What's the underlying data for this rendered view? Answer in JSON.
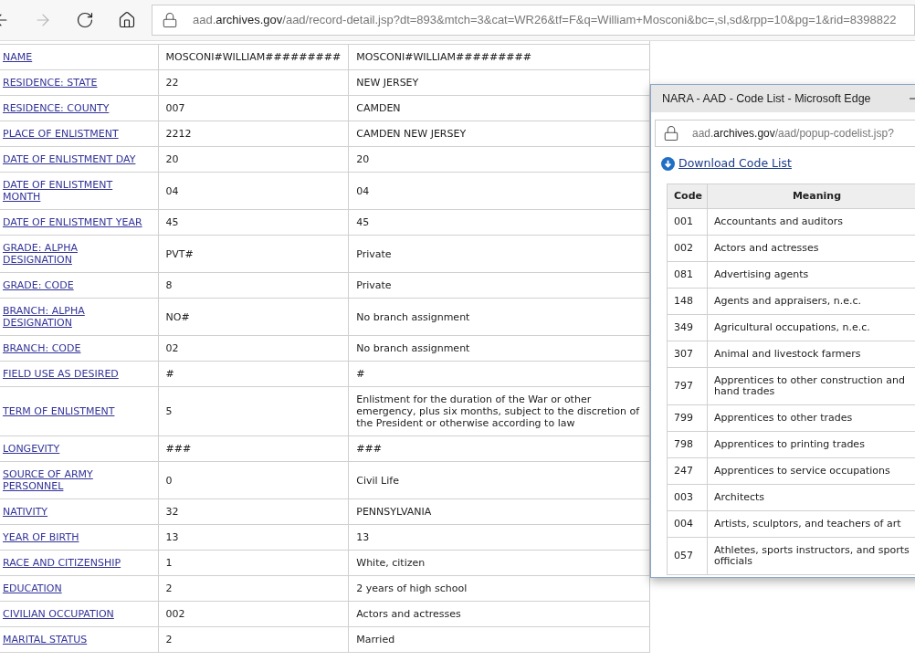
{
  "toolbar": {
    "nav_buttons": [
      {
        "kind": "back",
        "disabled": false
      },
      {
        "kind": "forward",
        "disabled": true
      },
      {
        "kind": "refresh",
        "disabled": false
      },
      {
        "kind": "home",
        "disabled": false
      }
    ],
    "address": {
      "subdomain": "aad.",
      "domain": "archives.gov",
      "path": "/aad/record-detail.jsp?dt=893&mtch=3&cat=WR26&tf=F&q=William+Mosconi&bc=,sl,sd&rpp=10&pg=1&rid=8398822"
    }
  },
  "record": {
    "rows": [
      {
        "field": "NAME",
        "code": "MOSCONI#WILLIAM#########",
        "meaning": "MOSCONI#WILLIAM#########"
      },
      {
        "field": "RESIDENCE: STATE",
        "code": "22",
        "meaning": "NEW JERSEY"
      },
      {
        "field": "RESIDENCE: COUNTY",
        "code": "007",
        "meaning": "CAMDEN"
      },
      {
        "field": "PLACE OF ENLISTMENT",
        "code": "2212",
        "meaning": "CAMDEN NEW JERSEY"
      },
      {
        "field": "DATE OF ENLISTMENT DAY",
        "code": "20",
        "meaning": "20"
      },
      {
        "field": "DATE OF ENLISTMENT MONTH",
        "code": "04",
        "meaning": "04"
      },
      {
        "field": "DATE OF ENLISTMENT YEAR",
        "code": "45",
        "meaning": "45"
      },
      {
        "field": "GRADE: ALPHA DESIGNATION",
        "code": "PVT#",
        "meaning": "Private"
      },
      {
        "field": "GRADE: CODE",
        "code": "8",
        "meaning": "Private"
      },
      {
        "field": "BRANCH: ALPHA DESIGNATION",
        "code": "NO#",
        "meaning": "No branch assignment"
      },
      {
        "field": "BRANCH: CODE",
        "code": "02",
        "meaning": "No branch assignment"
      },
      {
        "field": "FIELD USE AS DESIRED",
        "code": "#",
        "meaning": "#"
      },
      {
        "field": "TERM OF ENLISTMENT",
        "code": "5",
        "meaning": "Enlistment for the duration of the War or other emergency, plus six months, subject to the discretion of the President or otherwise according to law"
      },
      {
        "field": "LONGEVITY",
        "code": "###",
        "meaning": "###"
      },
      {
        "field": "SOURCE OF ARMY PERSONNEL",
        "code": "0",
        "meaning": "Civil Life"
      },
      {
        "field": "NATIVITY",
        "code": "32",
        "meaning": "PENNSYLVANIA"
      },
      {
        "field": "YEAR OF BIRTH",
        "code": "13",
        "meaning": "13"
      },
      {
        "field": "RACE AND CITIZENSHIP",
        "code": "1",
        "meaning": "White, citizen"
      },
      {
        "field": "EDUCATION",
        "code": "2",
        "meaning": "2 years of high school"
      },
      {
        "field": "CIVILIAN OCCUPATION",
        "code": "002",
        "meaning": "Actors and actresses"
      },
      {
        "field": "MARITAL STATUS",
        "code": "2",
        "meaning": "Married"
      }
    ]
  },
  "popup": {
    "title": "NARA - AAD - Code List - Microsoft Edge",
    "address": {
      "subdomain": "aad.",
      "domain": "archives.gov",
      "path": "/aad/popup-codelist.jsp?"
    },
    "download_link": "Download Code List",
    "columns": [
      "Code",
      "Meaning"
    ],
    "rows": [
      {
        "code": "001",
        "meaning": "Accountants and auditors"
      },
      {
        "code": "002",
        "meaning": "Actors and actresses"
      },
      {
        "code": "081",
        "meaning": "Advertising agents"
      },
      {
        "code": "148",
        "meaning": "Agents and appraisers, n.e.c."
      },
      {
        "code": "349",
        "meaning": "Agricultural occupations, n.e.c."
      },
      {
        "code": "307",
        "meaning": "Animal and livestock farmers"
      },
      {
        "code": "797",
        "meaning": "Apprentices to other construction and hand trades"
      },
      {
        "code": "799",
        "meaning": "Apprentices to other trades"
      },
      {
        "code": "798",
        "meaning": "Apprentices to printing trades"
      },
      {
        "code": "247",
        "meaning": "Apprentices to service occupations"
      },
      {
        "code": "003",
        "meaning": "Architects"
      },
      {
        "code": "004",
        "meaning": "Artists, sculptors, and teachers of art"
      },
      {
        "code": "057",
        "meaning": "Athletes, sports instructors, and sports officials"
      }
    ]
  }
}
